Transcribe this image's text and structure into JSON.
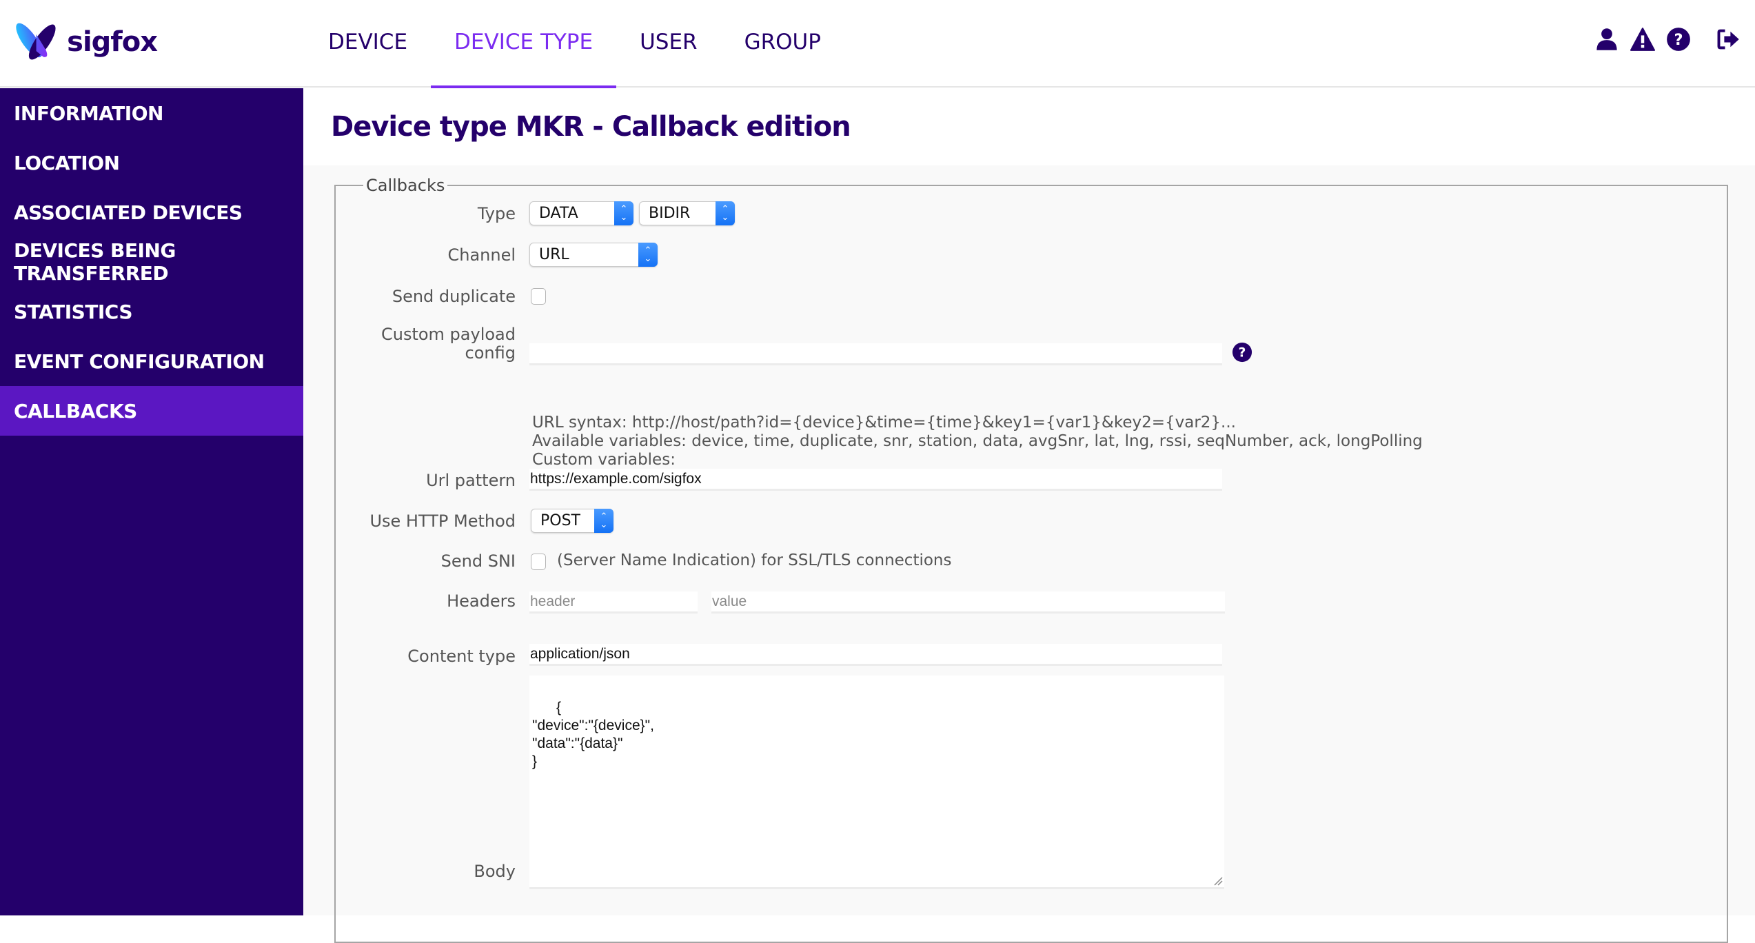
{
  "brand": {
    "name": "sigfox",
    "primary": "#24006b",
    "accent": "#7b2bf0",
    "active_sidebar": "#5b17c2"
  },
  "nav": {
    "items": [
      {
        "label": "DEVICE",
        "active": false
      },
      {
        "label": "DEVICE TYPE",
        "active": true
      },
      {
        "label": "USER",
        "active": false
      },
      {
        "label": "GROUP",
        "active": false
      }
    ],
    "icons": [
      "user-icon",
      "warning-icon",
      "help-icon",
      "logout-icon"
    ]
  },
  "sidebar": {
    "items": [
      {
        "label": "INFORMATION"
      },
      {
        "label": "LOCATION"
      },
      {
        "label": "ASSOCIATED DEVICES"
      },
      {
        "label": "DEVICES BEING TRANSFERRED"
      },
      {
        "label": "STATISTICS"
      },
      {
        "label": "EVENT CONFIGURATION"
      },
      {
        "label": "CALLBACKS",
        "active": true
      }
    ]
  },
  "page": {
    "title": "Device type MKR - Callback edition"
  },
  "form": {
    "legend": "Callbacks",
    "type": {
      "label": "Type",
      "value1": "DATA",
      "value2": "BIDIR"
    },
    "channel": {
      "label": "Channel",
      "value": "URL"
    },
    "send_duplicate": {
      "label": "Send duplicate",
      "checked": false
    },
    "custom_payload": {
      "label_line1": "Custom payload",
      "label_line2": "config",
      "value": ""
    },
    "help": {
      "url_syntax": "URL syntax: http://host/path?id={device}&time={time}&key1={var1}&key2={var2}...",
      "available_vars": "Available variables: device, time, duplicate, snr, station, data, avgSnr, lat, lng, rssi, seqNumber, ack, longPolling",
      "custom_vars": "Custom variables:"
    },
    "url_pattern": {
      "label": "Url pattern",
      "value": "https://example.com/sigfox"
    },
    "http_method": {
      "label": "Use HTTP Method",
      "value": "POST"
    },
    "send_sni": {
      "label": "Send SNI",
      "checked": false,
      "description": "(Server Name Indication) for SSL/TLS connections"
    },
    "headers": {
      "label": "Headers",
      "header_placeholder": "header",
      "value_placeholder": "value"
    },
    "content_type": {
      "label": "Content type",
      "value": "application/json"
    },
    "body": {
      "label": "Body",
      "value": "{\n\"device\":\"{device}\",\n\"data\":\"{data}\"\n}"
    }
  }
}
